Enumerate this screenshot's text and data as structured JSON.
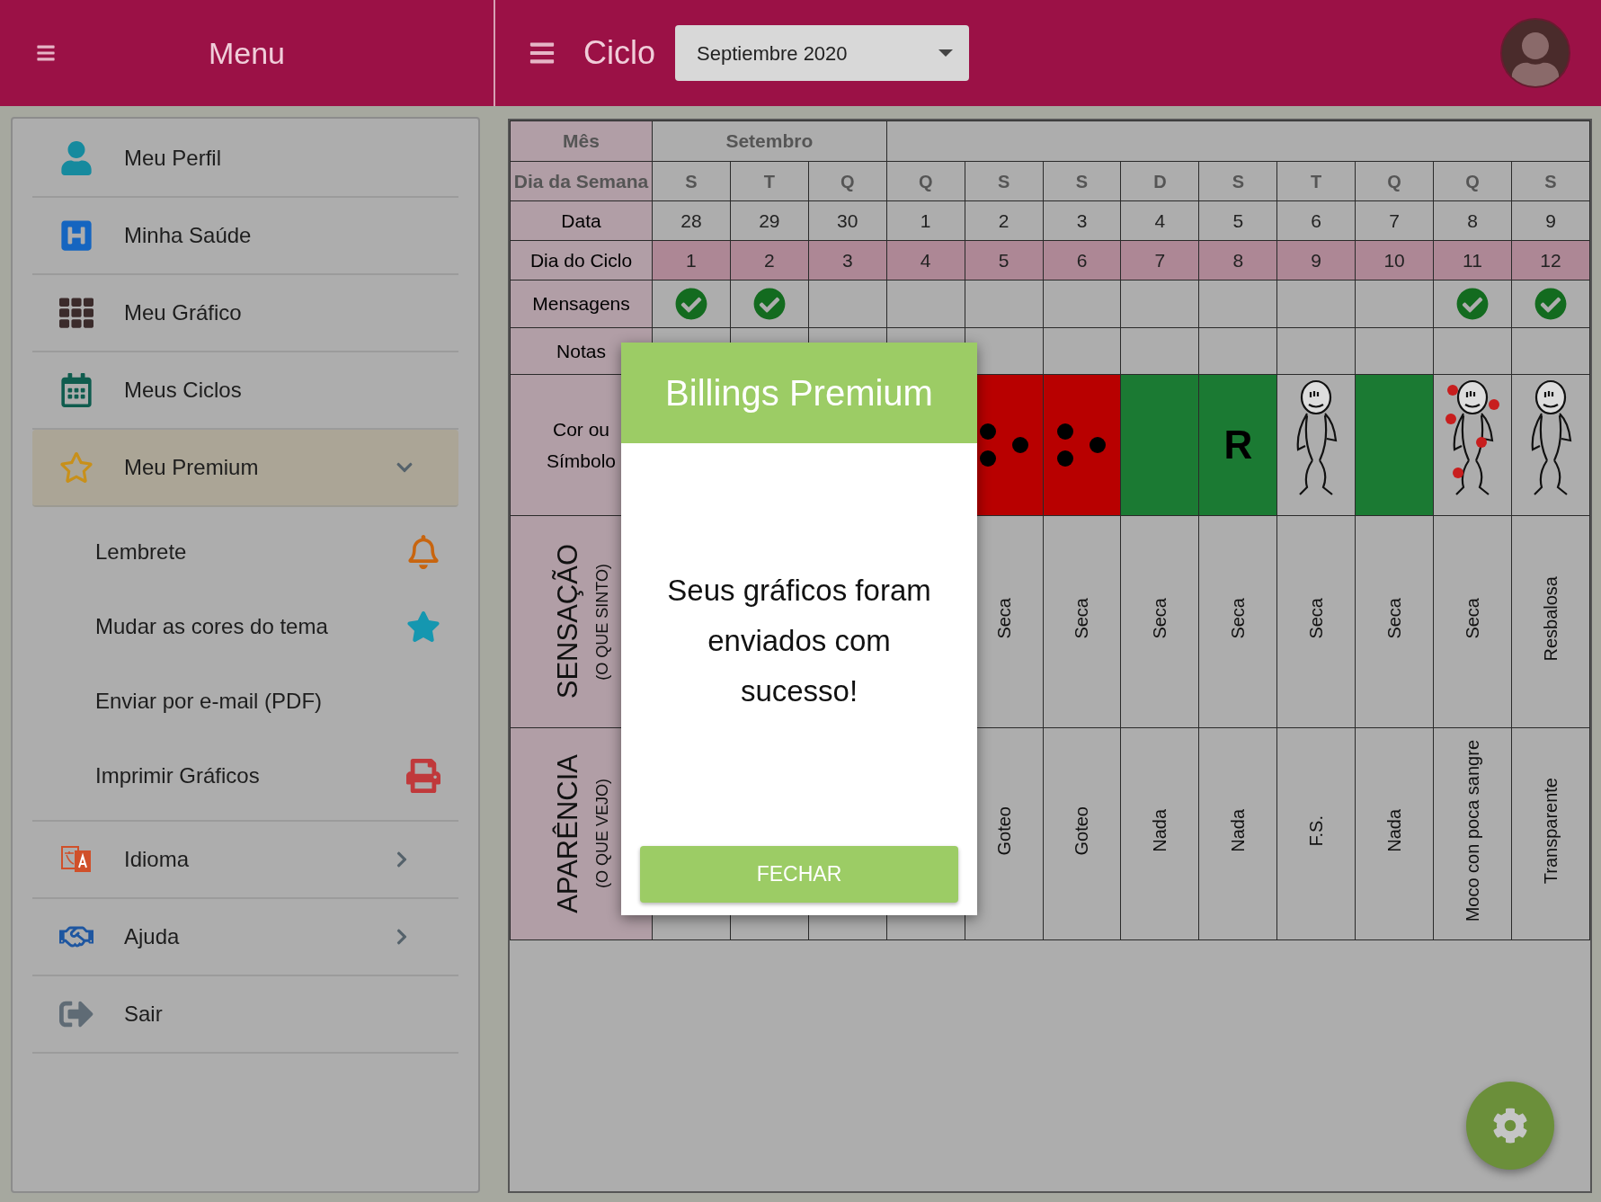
{
  "sidebar": {
    "title": "Menu",
    "items": [
      {
        "label": "Meu Perfil",
        "kind": "link"
      },
      {
        "label": "Minha Saúde",
        "kind": "link"
      },
      {
        "label": "Meu Gráfico",
        "kind": "link"
      },
      {
        "label": "Meus Ciclos",
        "kind": "link"
      },
      {
        "label": "Meu Premium",
        "kind": "group",
        "expanded": true,
        "children": [
          {
            "label": "Lembrete"
          },
          {
            "label": "Mudar as cores do tema"
          },
          {
            "label": "Enviar por e-mail (PDF)"
          },
          {
            "label": "Imprimir Gráficos"
          }
        ]
      },
      {
        "label": "Idioma",
        "kind": "group",
        "expanded": false
      },
      {
        "label": "Ajuda",
        "kind": "group",
        "expanded": false
      },
      {
        "label": "Sair",
        "kind": "link"
      }
    ]
  },
  "header": {
    "title": "Ciclo",
    "period_select": {
      "value": "Septiembre 2020"
    }
  },
  "table": {
    "row_labels": {
      "month": "Mês",
      "weekday": "Dia da Semana",
      "date": "Data",
      "cycle_day": "Dia do Ciclo",
      "messages": "Mensagens",
      "notes": "Notas",
      "symbol": "Cor ou Símbolo",
      "sensation": "SENSAÇÃO",
      "sensation_sub": "(O QUE SINTO)",
      "appearance": "APARÊNCIA",
      "appearance_sub": "(O QUE VEJO)"
    },
    "month": "Setembro",
    "days": [
      {
        "weekday": "S",
        "date": "28",
        "cycle_day": "1",
        "message": true
      },
      {
        "weekday": "T",
        "date": "29",
        "cycle_day": "2",
        "message": true
      },
      {
        "weekday": "Q",
        "date": "30",
        "cycle_day": "3",
        "message": false
      },
      {
        "weekday": "Q",
        "date": "1",
        "cycle_day": "4",
        "message": false
      },
      {
        "weekday": "S",
        "date": "2",
        "cycle_day": "5",
        "message": false,
        "symbol": {
          "kind": "red_dots"
        },
        "sensation": "Seca",
        "appearance": "Goteo"
      },
      {
        "weekday": "S",
        "date": "3",
        "cycle_day": "6",
        "message": false,
        "symbol": {
          "kind": "red_dots"
        },
        "sensation": "Seca",
        "appearance": "Goteo"
      },
      {
        "weekday": "D",
        "date": "4",
        "cycle_day": "7",
        "message": false,
        "symbol": {
          "kind": "green"
        },
        "sensation": "Seca",
        "appearance": "Nada"
      },
      {
        "weekday": "S",
        "date": "5",
        "cycle_day": "8",
        "message": false,
        "symbol": {
          "kind": "green",
          "text": "R"
        },
        "sensation": "Seca",
        "appearance": "Nada"
      },
      {
        "weekday": "T",
        "date": "6",
        "cycle_day": "9",
        "message": false,
        "symbol": {
          "kind": "baby"
        },
        "sensation": "Seca",
        "appearance": "F.S."
      },
      {
        "weekday": "Q",
        "date": "7",
        "cycle_day": "10",
        "message": false,
        "symbol": {
          "kind": "green"
        },
        "sensation": "Seca",
        "appearance": "Nada"
      },
      {
        "weekday": "Q",
        "date": "8",
        "cycle_day": "11",
        "message": true,
        "symbol": {
          "kind": "baby_dots"
        },
        "sensation": "Seca",
        "appearance": "Moco con poca sangre"
      },
      {
        "weekday": "S",
        "date": "9",
        "cycle_day": "12",
        "message": true,
        "symbol": {
          "kind": "baby"
        },
        "sensation": "Resbalosa",
        "appearance": "Transparente"
      }
    ]
  },
  "dialog": {
    "title": "Billings Premium",
    "message": "Seus gráficos foram enviados com sucesso!",
    "button": "FECHAR"
  }
}
